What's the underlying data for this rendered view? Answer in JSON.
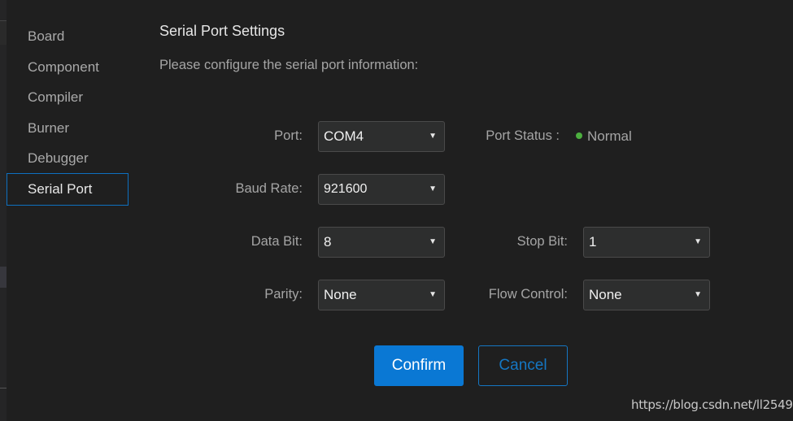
{
  "sidebar": {
    "items": [
      {
        "label": "Board",
        "active": false
      },
      {
        "label": "Component",
        "active": false
      },
      {
        "label": "Compiler",
        "active": false
      },
      {
        "label": "Burner",
        "active": false
      },
      {
        "label": "Debugger",
        "active": false
      },
      {
        "label": "Serial Port",
        "active": true
      }
    ]
  },
  "header": {
    "title": "Serial Port Settings",
    "subtitle": "Please configure the serial port information:"
  },
  "form": {
    "port": {
      "label": "Port:",
      "value": "COM4"
    },
    "port_status": {
      "label": "Port Status :",
      "value": "Normal",
      "color": "#4caf3f"
    },
    "baud_rate": {
      "label": "Baud Rate:",
      "value": "921600"
    },
    "data_bit": {
      "label": "Data Bit:",
      "value": "8"
    },
    "stop_bit": {
      "label": "Stop Bit:",
      "value": "1"
    },
    "parity": {
      "label": "Parity:",
      "value": "None"
    },
    "flow_control": {
      "label": "Flow Control:",
      "value": "None"
    },
    "caret_icon": "▼"
  },
  "buttons": {
    "confirm": "Confirm",
    "cancel": "Cancel"
  },
  "watermark": "https://blog.csdn.net/ll2549",
  "colors": {
    "accent": "#0a78d4",
    "background": "#1f1f1f",
    "status_ok": "#4caf3f"
  }
}
